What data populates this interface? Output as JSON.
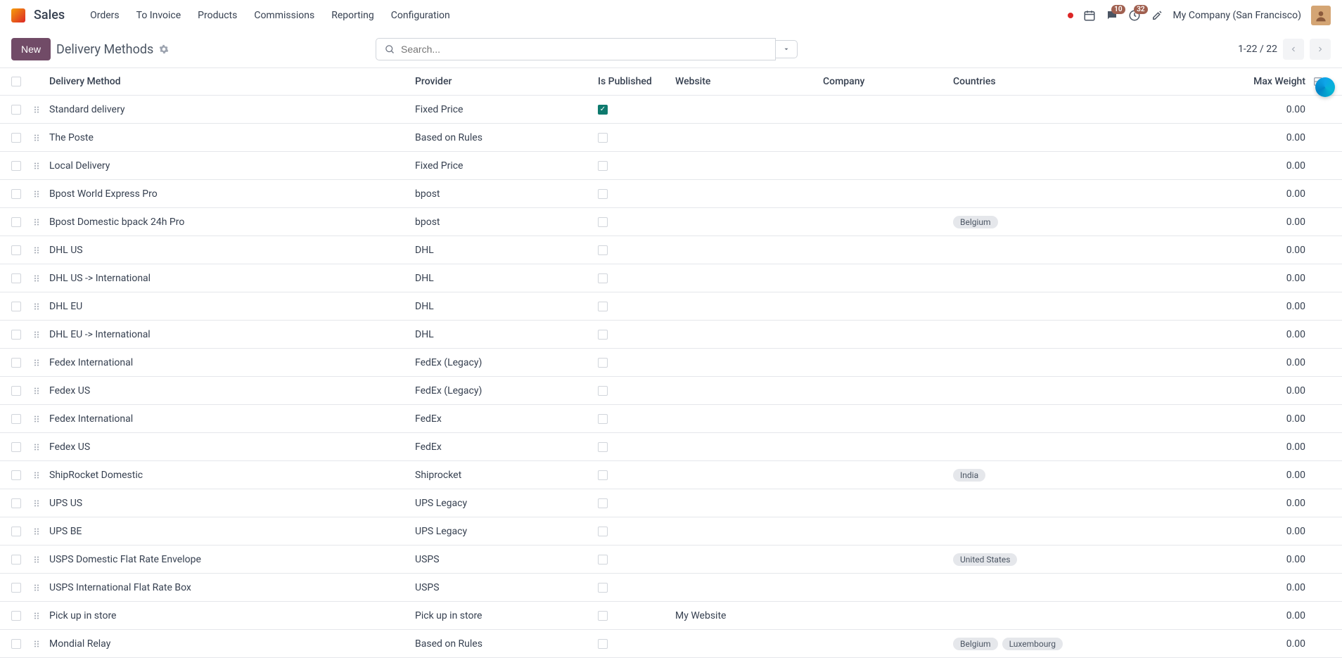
{
  "nav": {
    "app_name": "Sales",
    "items": [
      "Orders",
      "To Invoice",
      "Products",
      "Commissions",
      "Reporting",
      "Configuration"
    ],
    "company": "My Company (San Francisco)",
    "chat_badge": "10",
    "activity_badge": "32"
  },
  "subheader": {
    "new_label": "New",
    "title": "Delivery Methods",
    "search_placeholder": "Search...",
    "pager": "1-22 / 22"
  },
  "columns": {
    "method": "Delivery Method",
    "provider": "Provider",
    "published": "Is Published",
    "website": "Website",
    "company": "Company",
    "countries": "Countries",
    "weight": "Max Weight"
  },
  "rows": [
    {
      "method": "Standard delivery",
      "provider": "Fixed Price",
      "published": true,
      "website": "",
      "company": "",
      "countries": [],
      "weight": "0.00"
    },
    {
      "method": "The Poste",
      "provider": "Based on Rules",
      "published": false,
      "website": "",
      "company": "",
      "countries": [],
      "weight": "0.00"
    },
    {
      "method": "Local Delivery",
      "provider": "Fixed Price",
      "published": false,
      "website": "",
      "company": "",
      "countries": [],
      "weight": "0.00"
    },
    {
      "method": "Bpost World Express Pro",
      "provider": "bpost",
      "published": false,
      "website": "",
      "company": "",
      "countries": [],
      "weight": "0.00"
    },
    {
      "method": "Bpost Domestic bpack 24h Pro",
      "provider": "bpost",
      "published": false,
      "website": "",
      "company": "",
      "countries": [
        "Belgium"
      ],
      "weight": "0.00"
    },
    {
      "method": "DHL US",
      "provider": "DHL",
      "published": false,
      "website": "",
      "company": "",
      "countries": [],
      "weight": "0.00"
    },
    {
      "method": "DHL US -> International",
      "provider": "DHL",
      "published": false,
      "website": "",
      "company": "",
      "countries": [],
      "weight": "0.00"
    },
    {
      "method": "DHL EU",
      "provider": "DHL",
      "published": false,
      "website": "",
      "company": "",
      "countries": [],
      "weight": "0.00"
    },
    {
      "method": "DHL EU -> International",
      "provider": "DHL",
      "published": false,
      "website": "",
      "company": "",
      "countries": [],
      "weight": "0.00"
    },
    {
      "method": "Fedex International",
      "provider": "FedEx (Legacy)",
      "published": false,
      "website": "",
      "company": "",
      "countries": [],
      "weight": "0.00"
    },
    {
      "method": "Fedex US",
      "provider": "FedEx (Legacy)",
      "published": false,
      "website": "",
      "company": "",
      "countries": [],
      "weight": "0.00"
    },
    {
      "method": "Fedex International",
      "provider": "FedEx",
      "published": false,
      "website": "",
      "company": "",
      "countries": [],
      "weight": "0.00"
    },
    {
      "method": "Fedex US",
      "provider": "FedEx",
      "published": false,
      "website": "",
      "company": "",
      "countries": [],
      "weight": "0.00"
    },
    {
      "method": "ShipRocket Domestic",
      "provider": "Shiprocket",
      "published": false,
      "website": "",
      "company": "",
      "countries": [
        "India"
      ],
      "weight": "0.00"
    },
    {
      "method": "UPS US",
      "provider": "UPS Legacy",
      "published": false,
      "website": "",
      "company": "",
      "countries": [],
      "weight": "0.00"
    },
    {
      "method": "UPS BE",
      "provider": "UPS Legacy",
      "published": false,
      "website": "",
      "company": "",
      "countries": [],
      "weight": "0.00"
    },
    {
      "method": "USPS Domestic Flat Rate Envelope",
      "provider": "USPS",
      "published": false,
      "website": "",
      "company": "",
      "countries": [
        "United States"
      ],
      "weight": "0.00"
    },
    {
      "method": "USPS International Flat Rate Box",
      "provider": "USPS",
      "published": false,
      "website": "",
      "company": "",
      "countries": [],
      "weight": "0.00"
    },
    {
      "method": "Pick up in store",
      "provider": "Pick up in store",
      "published": false,
      "website": "My Website",
      "company": "",
      "countries": [],
      "weight": "0.00"
    },
    {
      "method": "Mondial Relay",
      "provider": "Based on Rules",
      "published": false,
      "website": "",
      "company": "",
      "countries": [
        "Belgium",
        "Luxembourg"
      ],
      "weight": "0.00"
    }
  ]
}
